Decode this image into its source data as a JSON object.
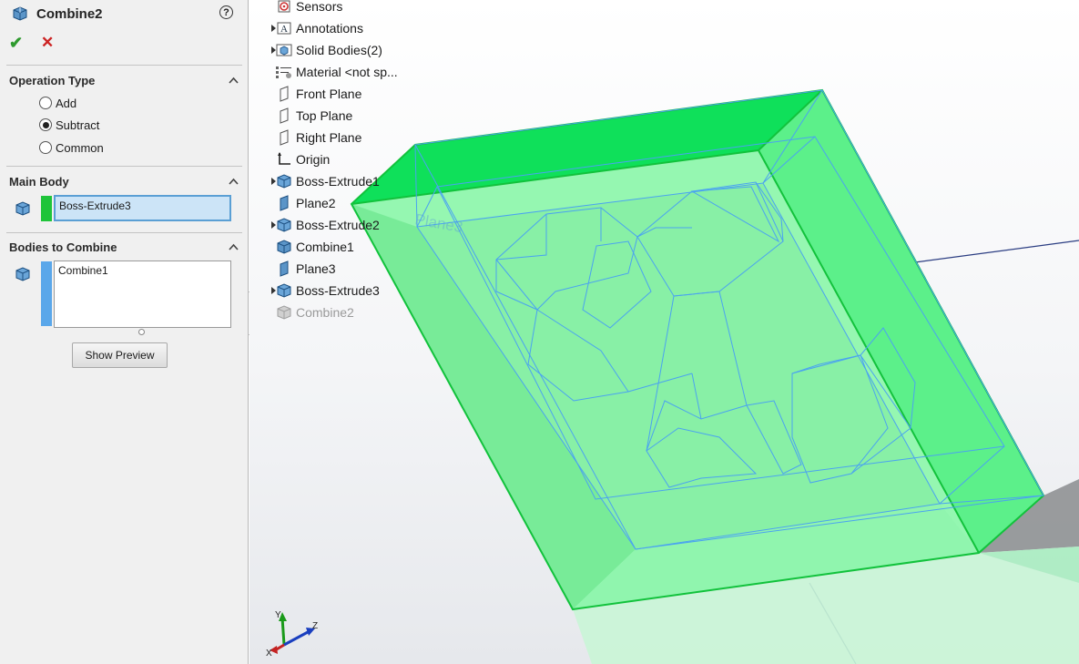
{
  "feature": {
    "title": "Combine2",
    "help_icon": "help-circle-icon"
  },
  "actions": {
    "ok_icon": "checkmark-icon",
    "cancel_icon": "close-icon",
    "ok_color": "#2e9a2e",
    "cancel_color": "#cc2222"
  },
  "operation_type": {
    "title": "Operation Type",
    "options": [
      {
        "label": "Add",
        "selected": false
      },
      {
        "label": "Subtract",
        "selected": true
      },
      {
        "label": "Common",
        "selected": false
      }
    ]
  },
  "main_body": {
    "title": "Main Body",
    "value": "Boss-Extrude3",
    "color": "#1fc43a"
  },
  "bodies_to_combine": {
    "title": "Bodies to Combine",
    "items": [
      "Combine1"
    ],
    "color": "#5aa7ea"
  },
  "preview_button": {
    "label": "Show Preview"
  },
  "tree": {
    "items": [
      {
        "label": "Sensors",
        "icon": "sensor-icon",
        "expandable": false,
        "dim": false
      },
      {
        "label": "Annotations",
        "icon": "annotation-icon",
        "expandable": true,
        "dim": false
      },
      {
        "label": "Solid Bodies(2)",
        "icon": "solid-bodies-folder-icon",
        "expandable": true,
        "dim": false
      },
      {
        "label": "Material <not sp...",
        "icon": "material-icon",
        "expandable": false,
        "dim": false
      },
      {
        "label": "Front Plane",
        "icon": "plane-icon",
        "expandable": false,
        "dim": false
      },
      {
        "label": "Top Plane",
        "icon": "plane-icon",
        "expandable": false,
        "dim": false
      },
      {
        "label": "Right Plane",
        "icon": "plane-icon",
        "expandable": false,
        "dim": false
      },
      {
        "label": "Origin",
        "icon": "origin-icon",
        "expandable": false,
        "dim": false
      },
      {
        "label": "Boss-Extrude1",
        "icon": "extrude-icon",
        "expandable": true,
        "dim": false
      },
      {
        "label": "Plane2",
        "icon": "plane-solid-icon",
        "expandable": false,
        "dim": false
      },
      {
        "label": "Boss-Extrude2",
        "icon": "extrude-icon",
        "expandable": true,
        "dim": false
      },
      {
        "label": "Combine1",
        "icon": "combine-icon",
        "expandable": false,
        "dim": false
      },
      {
        "label": "Plane3",
        "icon": "plane-solid-icon",
        "expandable": false,
        "dim": false
      },
      {
        "label": "Boss-Extrude3",
        "icon": "extrude-icon",
        "expandable": true,
        "dim": false
      },
      {
        "label": "Combine2",
        "icon": "combine-icon",
        "expandable": false,
        "dim": true
      }
    ]
  },
  "viewport": {
    "plane_label": "Plane3",
    "model_color": "#22dd44"
  },
  "triad": {
    "x_label": "X",
    "y_label": "Y",
    "z_label": "Z"
  }
}
